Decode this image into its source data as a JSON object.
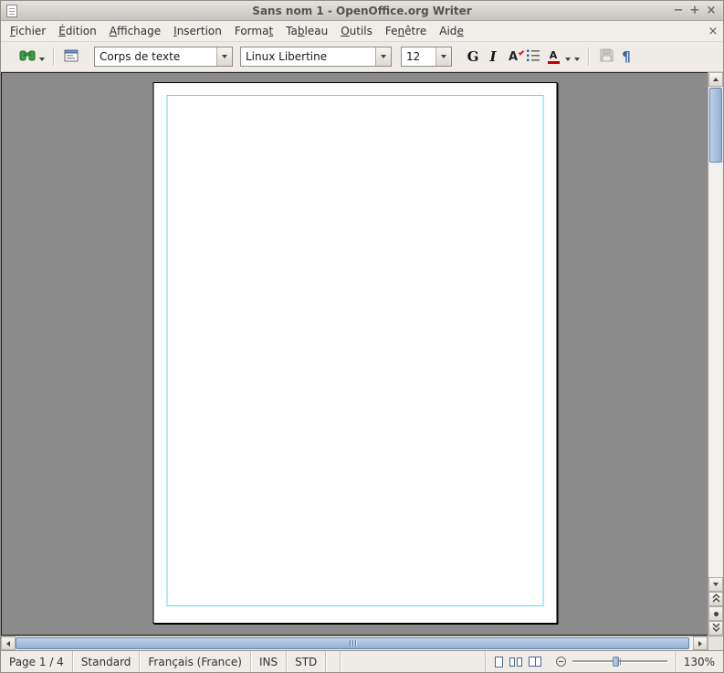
{
  "titlebar": {
    "title": "Sans nom 1 - OpenOffice.org Writer",
    "minimize_glyph": "−",
    "maximize_glyph": "+",
    "close_glyph": "×"
  },
  "menubar": {
    "items": [
      {
        "pre": "",
        "key": "F",
        "post": "ichier"
      },
      {
        "pre": "",
        "key": "É",
        "post": "dition"
      },
      {
        "pre": "",
        "key": "A",
        "post": "ffichage"
      },
      {
        "pre": "",
        "key": "I",
        "post": "nsertion"
      },
      {
        "pre": "Forma",
        "key": "t",
        "post": ""
      },
      {
        "pre": "Ta",
        "key": "b",
        "post": "leau"
      },
      {
        "pre": "",
        "key": "O",
        "post": "utils"
      },
      {
        "pre": "Fe",
        "key": "n",
        "post": "être"
      },
      {
        "pre": "Aid",
        "key": "e",
        "post": ""
      }
    ],
    "close_glyph": "×"
  },
  "toolbar": {
    "paragraph_style_value": "Corps de texte",
    "font_name_value": "Linux Libertine",
    "font_size_value": "12",
    "bold_glyph": "G",
    "italic_glyph": "I",
    "spellcheck_glyph": "A",
    "font_color_glyph": "A",
    "pilcrow_glyph": "¶"
  },
  "statusbar": {
    "page": "Page 1 / 4",
    "page_style": "Standard",
    "language": "Français (France)",
    "insert_mode": "INS",
    "selection_mode": "STD",
    "zoom_level": "130%"
  },
  "colors": {
    "accent_blue": "#3465a4",
    "scrollbar_thumb": "#92b0d4",
    "margin_guide": "#62d8ea",
    "canvas_gray": "#8b8b8b",
    "font_color_red": "#c00000"
  }
}
